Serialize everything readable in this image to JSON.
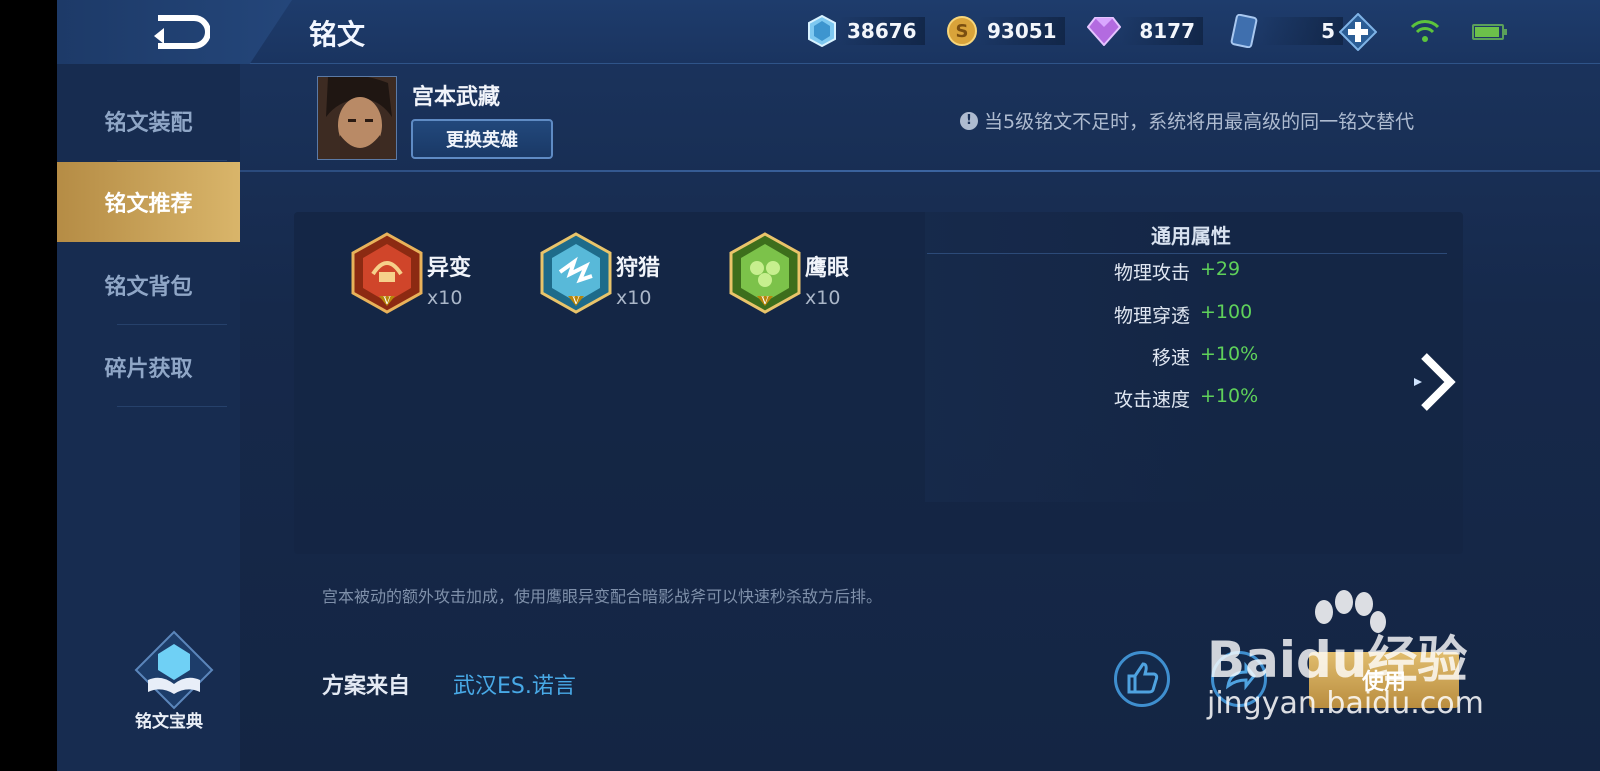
{
  "header": {
    "page_title": "铭文",
    "currencies": [
      {
        "icon": "crystal-icon",
        "value": "38676"
      },
      {
        "icon": "gold-coin-icon",
        "value": "93051"
      },
      {
        "icon": "diamond-icon",
        "value": "8177"
      },
      {
        "icon": "card-icon",
        "value": "5"
      }
    ]
  },
  "sidebar": {
    "items": [
      {
        "label": "铭文装配",
        "active": false
      },
      {
        "label": "铭文推荐",
        "active": true
      },
      {
        "label": "铭文背包",
        "active": false
      },
      {
        "label": "碎片获取",
        "active": false
      }
    ],
    "codex_label": "铭文宝典"
  },
  "hero": {
    "name": "宫本武藏",
    "swap_label": "更换英雄",
    "notice": "当5级铭文不足时，系统将用最高级的同一铭文替代"
  },
  "runes": [
    {
      "name": "异变",
      "count": "x10",
      "color": "#c0392b",
      "tier": "V"
    },
    {
      "name": "狩猎",
      "count": "x10",
      "color": "#3aa6c9",
      "tier": "V"
    },
    {
      "name": "鹰眼",
      "count": "x10",
      "color": "#5fa83a",
      "tier": "V"
    }
  ],
  "attributes": {
    "title": "通用属性",
    "rows": [
      {
        "key": "物理攻击",
        "value": "+29"
      },
      {
        "key": "物理穿透",
        "value": "+100"
      },
      {
        "key": "移速",
        "value": "+10%"
      },
      {
        "key": "攻击速度",
        "value": "+10%"
      }
    ]
  },
  "description": "宫本被动的额外攻击加成，使用鹰眼异变配合暗影战斧可以快速秒杀敌方后排。",
  "source": {
    "label": "方案来自",
    "author": "武汉ES.诺言"
  },
  "actions": {
    "use_label": "使用"
  },
  "watermark": {
    "logo": "Baidu经验",
    "url": "jingyan.baidu.com"
  },
  "colors": {
    "accent_gold": "#d9b56a",
    "attr_value_green": "#5fd15a",
    "author_blue": "#48a9e6"
  }
}
